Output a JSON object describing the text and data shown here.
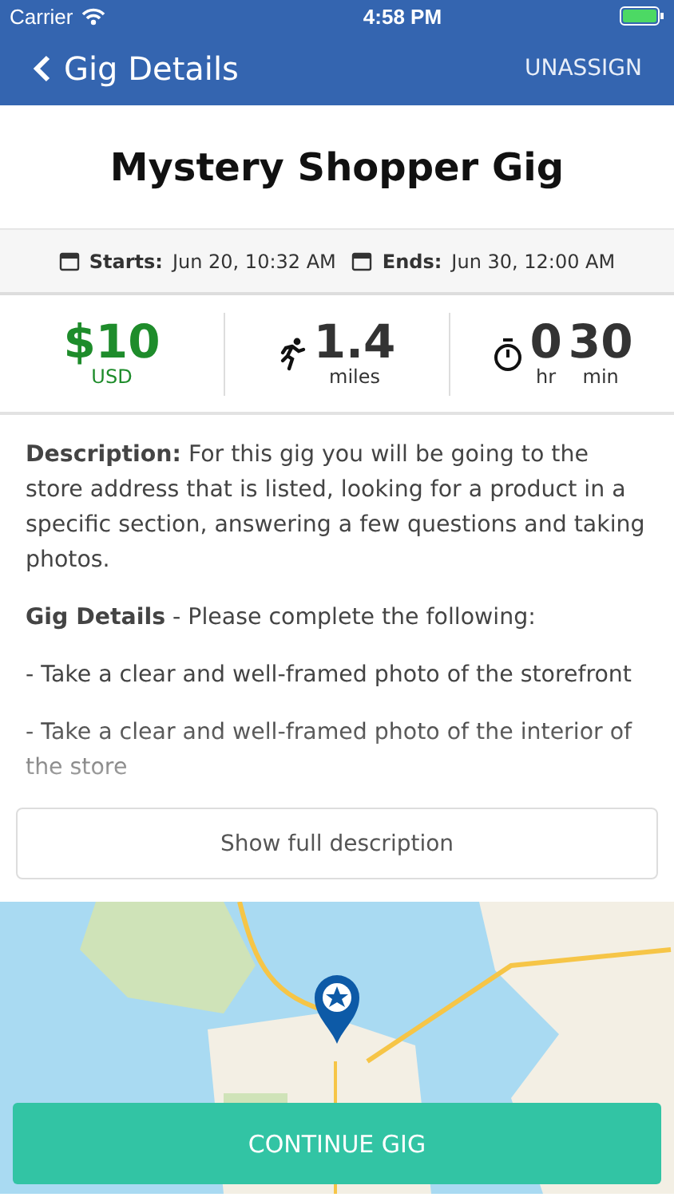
{
  "status_bar": {
    "carrier": "Carrier",
    "time": "4:58 PM"
  },
  "nav": {
    "title": "Gig Details",
    "action": "UNASSIGN"
  },
  "gig_title": "Mystery Shopper Gig",
  "dates": [
    {
      "label": "Starts:",
      "value": "Jun 20, 10:32 AM"
    },
    {
      "label": "Ends:",
      "value": "Jun 30, 12:00 AM"
    }
  ],
  "stats": {
    "pay": {
      "value": "$10",
      "unit": "USD"
    },
    "distance": {
      "value": "1.4",
      "unit": "miles"
    },
    "duration": [
      {
        "value": "0",
        "unit": "hr"
      },
      {
        "value": "30",
        "unit": "min"
      }
    ]
  },
  "description": [
    "**Description:** For this gig you will be going to the store address that is listed, looking for a product in a specific section, answering a few questions and taking photos.",
    "**Gig Details** - Please complete the following:",
    "- Take a clear and well-framed photo of the storefront",
    "- Take a clear and well-framed photo of the interior of the store"
  ],
  "show_more_button": "Show full description",
  "primary_button": "CONTINUE GIG"
}
